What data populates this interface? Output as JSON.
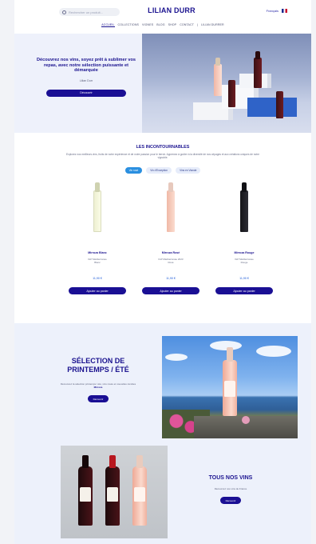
{
  "header": {
    "search_placeholder": "Rechercher un produit...",
    "brand": "LILIAN DURR",
    "lang": "Français",
    "nav": [
      "Accueil",
      "Collections",
      "Vignes",
      "Blog",
      "Shop",
      "Contact",
      "|",
      "Lilian Durrer"
    ]
  },
  "hero": {
    "title": "Découvrez nos vins, soyez prêt à sublimer vos repas, avec notre sélection puissante et démarquée",
    "subtitle": "Lilian Durr",
    "button": "Découvrir"
  },
  "incontournables": {
    "title": "LES INCONTOURNABLES",
    "description": "Explorez nos meilleurs vins, fruits de notre expérience et de notre passion pour le terroir. Apprenez à goûter à la diversité de nos cépages et aux créations uniques de notre vignoble.",
    "tabs": [
      "Vin rosé",
      "Vin d'Exception",
      "Vins en Viande"
    ],
    "products": [
      {
        "name": "Mirroza Blanc",
        "meta1": "IGP Méditerranée",
        "meta2": "Blanc",
        "price": "11,90 €",
        "button": "Ajouter au panier"
      },
      {
        "name": "Mirroza Rosé",
        "meta1": "IGP Méditerranée 2023",
        "meta2": "Rosé",
        "price": "11,90 €",
        "button": "Ajouter au panier"
      },
      {
        "name": "Mirroza Rouge",
        "meta1": "IGP Méditerranée",
        "meta2": "Rouge",
        "price": "11,90 €",
        "button": "Ajouter au panier"
      }
    ]
  },
  "spring": {
    "title": "SÉLECTION DE PRINTEMPS / ÉTÉ",
    "description": "Découvrez la sélection printemps / été, vins rosés et nouvelles récoltes",
    "description_bold": "Mirroza",
    "button": "Découvrir"
  },
  "all_wines": {
    "title": "TOUS NOS VINS",
    "description": "Découvrez nos vins de France",
    "button": "Découvrir"
  }
}
